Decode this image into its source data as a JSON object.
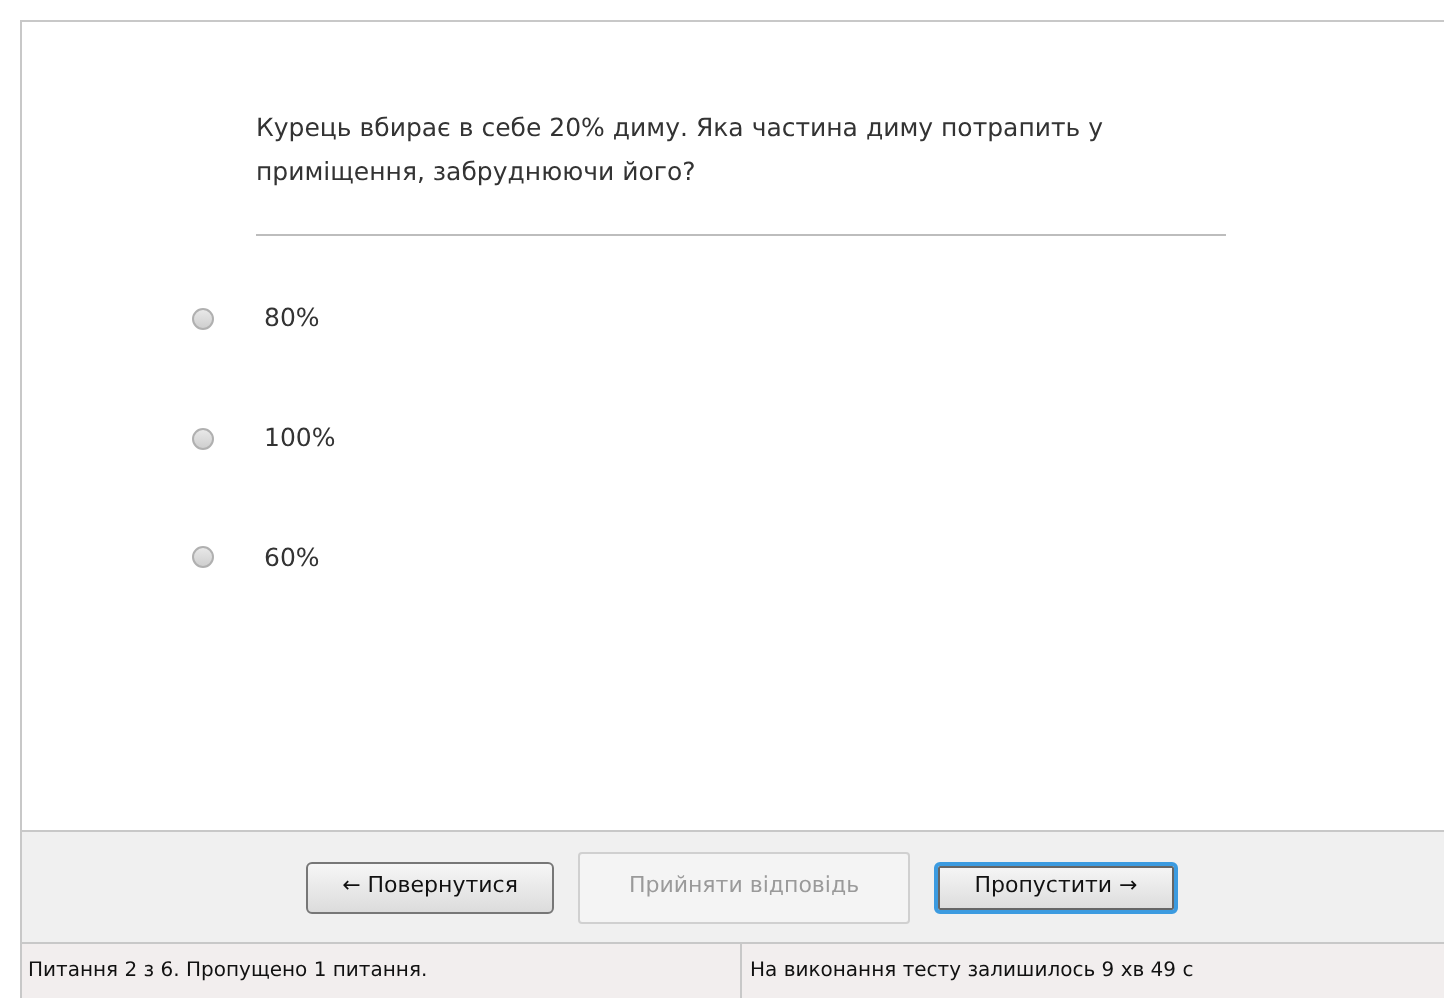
{
  "question": "Курець вбирає в себе 20% диму. Яка частина диму потрапить у приміщення, забруднюючи його?",
  "options": [
    {
      "label": "80%",
      "selected": false
    },
    {
      "label": "100%",
      "selected": false
    },
    {
      "label": "60%",
      "selected": false
    }
  ],
  "buttons": [
    {
      "label": "← Повернутися",
      "disabled": false,
      "focused": false
    },
    {
      "label": "Прийняти відповідь",
      "disabled": true,
      "focused": false
    },
    {
      "label": "Пропустити →",
      "disabled": false,
      "focused": true
    }
  ],
  "status_bar": {
    "progress": "Питання 2 з 6. Пропущено 1 питання.",
    "time_left": "На виконання тесту залишилось 9 хв 49 с"
  }
}
